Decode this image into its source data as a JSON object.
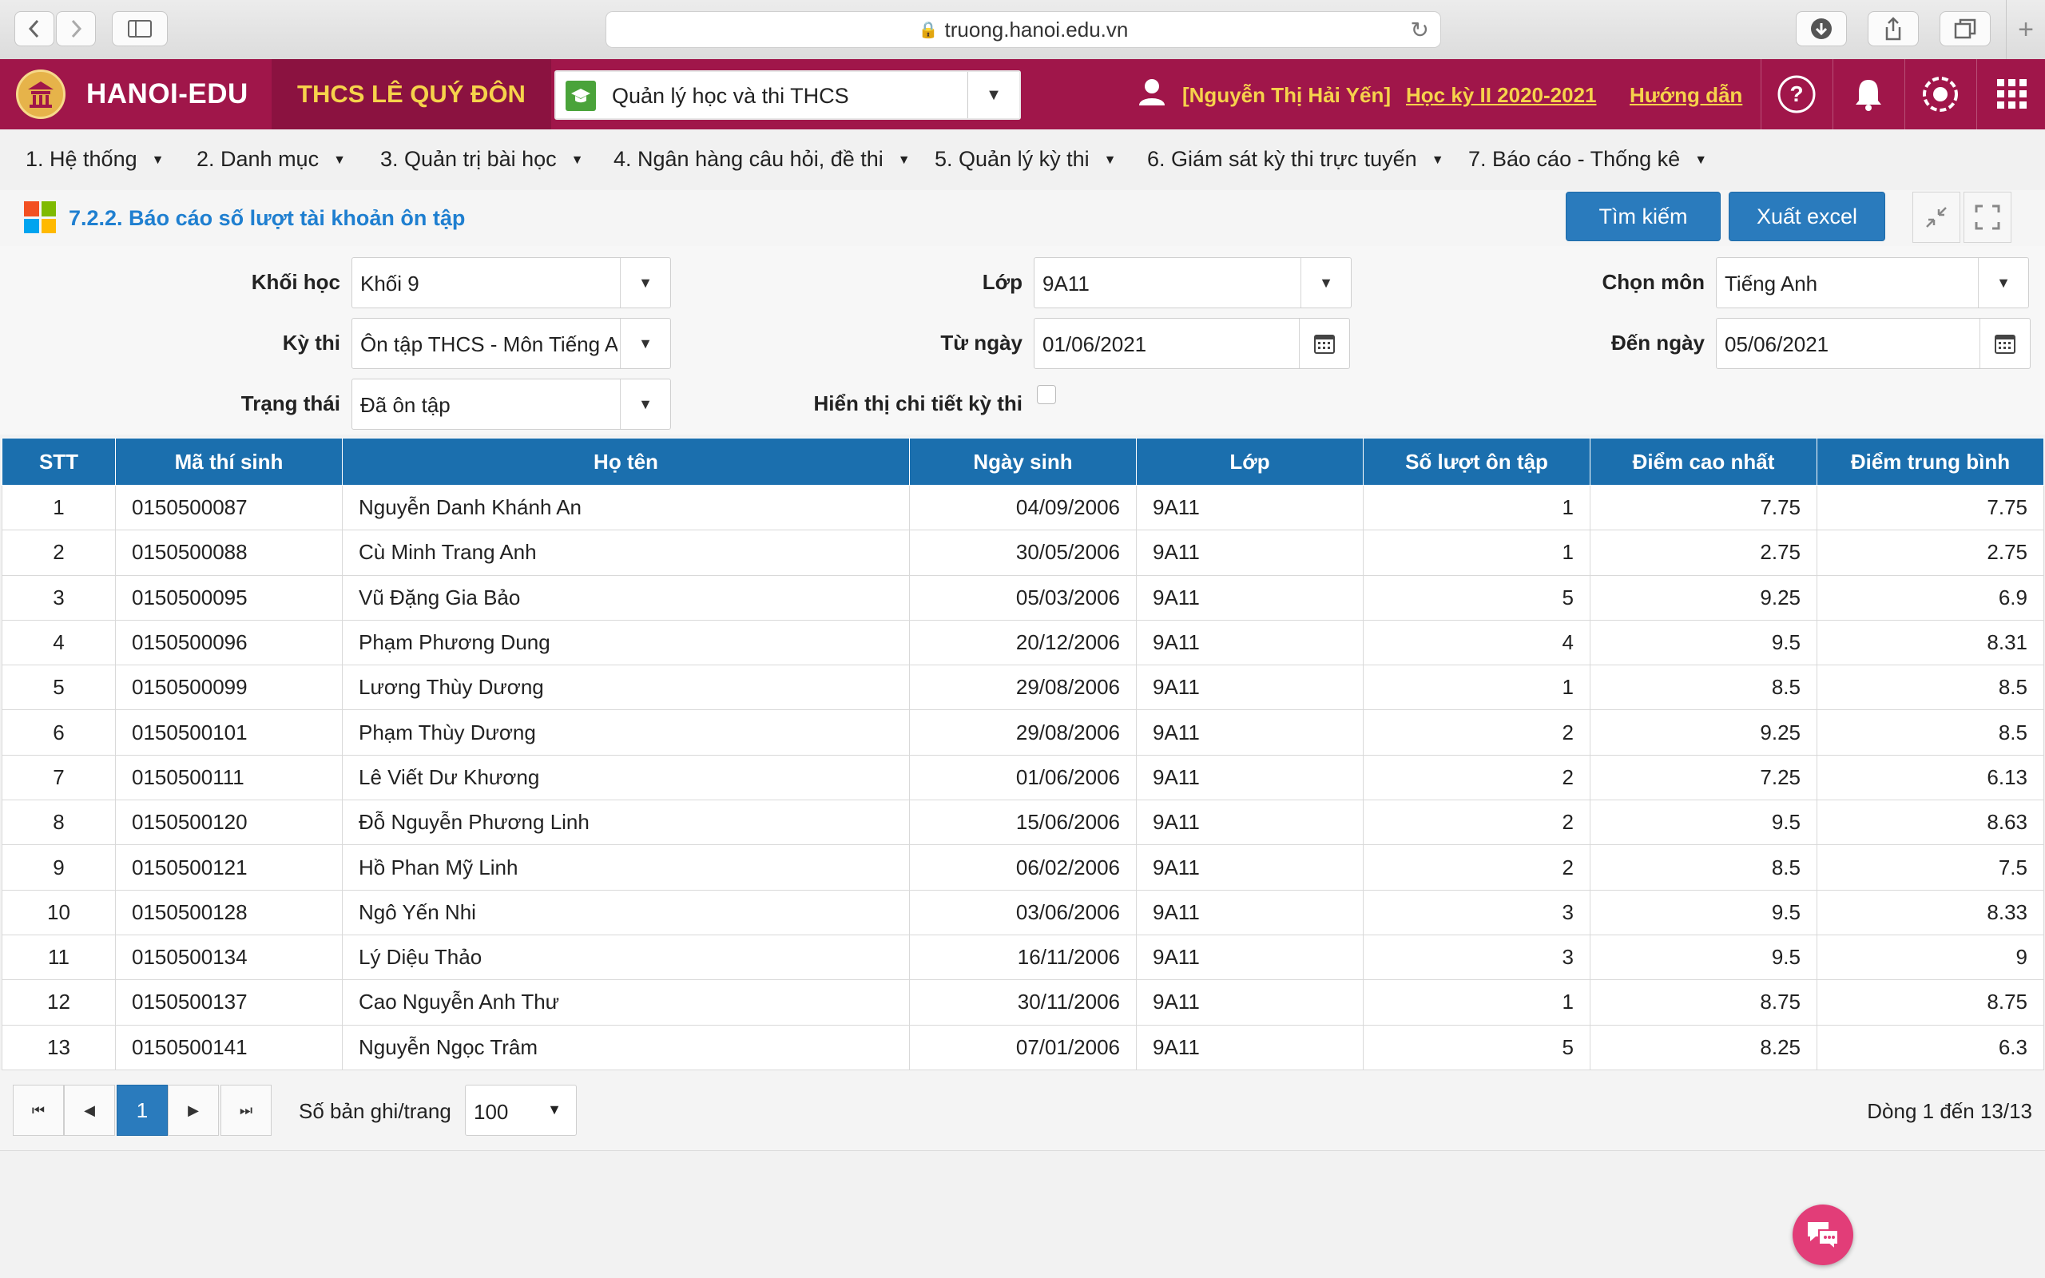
{
  "browser": {
    "url": "truong.hanoi.edu.vn"
  },
  "header": {
    "brand": "HANOI-EDU",
    "school": "THCS LÊ QUÝ ĐÔN",
    "module": "Quản lý học và thi THCS",
    "user": "[Nguyễn Thị Hải Yến]",
    "semester": "Học kỳ II 2020-2021",
    "guide": "Hướng dẫn",
    "color": "#a0164a"
  },
  "menu": [
    {
      "label": "1. Hệ thống"
    },
    {
      "label": "2. Danh mục"
    },
    {
      "label": "3. Quản trị bài học"
    },
    {
      "label": "4. Ngân hàng câu hỏi, đề thi"
    },
    {
      "label": "5. Quản lý kỳ thi"
    },
    {
      "label": "6. Giám sát kỳ thi trực tuyến"
    },
    {
      "label": "7. Báo cáo - Thống kê"
    }
  ],
  "page": {
    "title": "7.2.2. Báo cáo số lượt tài khoản ôn tập",
    "search_button": "Tìm kiếm",
    "export_button": "Xuất excel"
  },
  "filters": {
    "grade_label": "Khối học",
    "grade_value": "Khối 9",
    "class_label": "Lớp",
    "class_value": "9A11",
    "subject_label": "Chọn môn",
    "subject_value": "Tiếng Anh",
    "exam_label": "Kỳ thi",
    "exam_value": "Ôn tập THCS - Môn Tiếng Anh",
    "from_label": "Từ ngày",
    "from_value": "01/06/2021",
    "to_label": "Đến ngày",
    "to_value": "05/06/2021",
    "status_label": "Trạng thái",
    "status_value": "Đã ôn tập",
    "detail_label": "Hiển thị chi tiết kỳ thi",
    "detail_checked": false
  },
  "table": {
    "columns": [
      "STT",
      "Mã thí sinh",
      "Họ tên",
      "Ngày sinh",
      "Lớp",
      "Số lượt ôn tập",
      "Điểm cao nhất",
      "Điểm trung bình"
    ],
    "rows": [
      [
        "1",
        "0150500087",
        "Nguyễn Danh Khánh An",
        "04/09/2006",
        "9A11",
        "1",
        "7.75",
        "7.75"
      ],
      [
        "2",
        "0150500088",
        "Cù Minh Trang Anh",
        "30/05/2006",
        "9A11",
        "1",
        "2.75",
        "2.75"
      ],
      [
        "3",
        "0150500095",
        "Vũ Đặng Gia Bảo",
        "05/03/2006",
        "9A11",
        "5",
        "9.25",
        "6.9"
      ],
      [
        "4",
        "0150500096",
        "Phạm Phương Dung",
        "20/12/2006",
        "9A11",
        "4",
        "9.5",
        "8.31"
      ],
      [
        "5",
        "0150500099",
        "Lương Thùy Dương",
        "29/08/2006",
        "9A11",
        "1",
        "8.5",
        "8.5"
      ],
      [
        "6",
        "0150500101",
        "Phạm Thùy Dương",
        "29/08/2006",
        "9A11",
        "2",
        "9.25",
        "8.5"
      ],
      [
        "7",
        "0150500111",
        "Lê Viết Dư Khương",
        "01/06/2006",
        "9A11",
        "2",
        "7.25",
        "6.13"
      ],
      [
        "8",
        "0150500120",
        "Đỗ Nguyễn Phương Linh",
        "15/06/2006",
        "9A11",
        "2",
        "9.5",
        "8.63"
      ],
      [
        "9",
        "0150500121",
        "Hồ Phan Mỹ Linh",
        "06/02/2006",
        "9A11",
        "2",
        "8.5",
        "7.5"
      ],
      [
        "10",
        "0150500128",
        "Ngô Yến Nhi",
        "03/06/2006",
        "9A11",
        "3",
        "9.5",
        "8.33"
      ],
      [
        "11",
        "0150500134",
        "Lý Diệu Thảo",
        "16/11/2006",
        "9A11",
        "3",
        "9.5",
        "9"
      ],
      [
        "12",
        "0150500137",
        "Cao Nguyễn Anh Thư",
        "30/11/2006",
        "9A11",
        "1",
        "8.75",
        "8.75"
      ],
      [
        "13",
        "0150500141",
        "Nguyễn Ngọc Trâm",
        "07/01/2006",
        "9A11",
        "5",
        "8.25",
        "6.3"
      ]
    ]
  },
  "pager": {
    "current_page": "1",
    "per_page_label": "Số bản ghi/trang",
    "per_page_value": "100",
    "record_info": "Dòng 1 đến 13/13"
  }
}
